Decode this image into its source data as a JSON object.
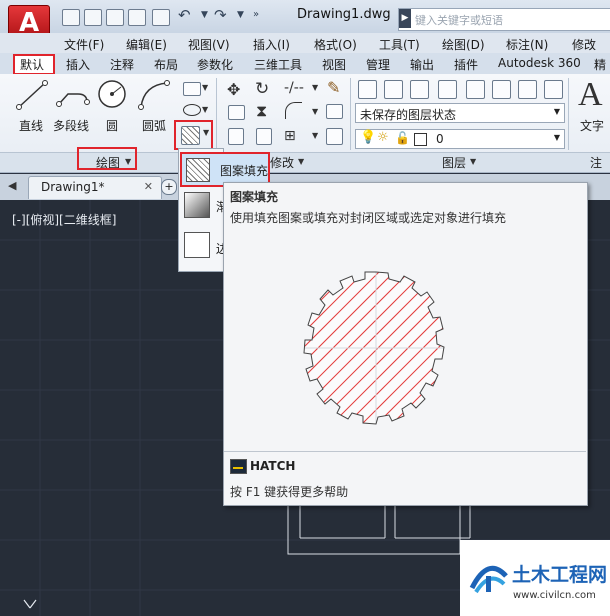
{
  "app": {
    "logo_letter": "A",
    "document_title": "Drawing1.dwg",
    "search_placeholder": "键入关键字或短语"
  },
  "menubar": [
    "文件(F)",
    "编辑(E)",
    "视图(V)",
    "插入(I)",
    "格式(O)",
    "工具(T)",
    "绘图(D)",
    "标注(N)",
    "修改(M"
  ],
  "ribbon_tabs": [
    "默认",
    "插入",
    "注释",
    "布局",
    "参数化",
    "三维工具",
    "视图",
    "管理",
    "输出",
    "插件",
    "Autodesk 360",
    "精"
  ],
  "draw_panel": {
    "buttons": [
      "直线",
      "多段线",
      "圆",
      "圆弧"
    ],
    "label": "绘图"
  },
  "modify_panel": {
    "label": "修改"
  },
  "layers_panel": {
    "label": "图层",
    "layer_state": "未保存的图层状态",
    "current_layer": "0"
  },
  "annotation_panel": {
    "text_button": "文字",
    "label": "注释",
    "big_letter": "A"
  },
  "doc_tabs": [
    "Drawing1*"
  ],
  "viewport_label": "[-][俯视][二维线框]",
  "dropdown": {
    "highlighted_item": "图案填充",
    "item2_partial": "渐",
    "item3_partial": "边"
  },
  "tooltip": {
    "title": "图案填充",
    "description": "使用填充图案或填充对封闭区域或选定对象进行填充",
    "command": "HATCH",
    "help": "按 F1 键获得更多帮助"
  },
  "watermark": {
    "brand": "土木工程网",
    "url": "www.civilcn.com"
  },
  "colors": {
    "accent_red": "#e0242c",
    "hatch_red": "#e33b3b",
    "canvas": "#262d38"
  }
}
